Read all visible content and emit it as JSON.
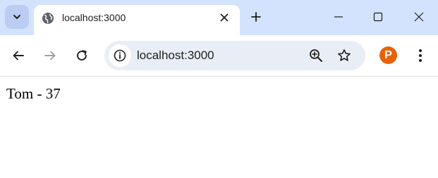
{
  "browser": {
    "tab": {
      "title": "localhost:3000",
      "icon": "globe-icon"
    },
    "address_bar": {
      "url": "localhost:3000",
      "icons": [
        "site-info-icon",
        "zoom-icon",
        "bookmark-star-icon"
      ]
    },
    "toolbar_icons": [
      "back-arrow-icon",
      "forward-arrow-icon",
      "reload-icon",
      "profile-extension-icon",
      "kebab-menu-icon"
    ],
    "window_controls": [
      "minimize-icon",
      "maximize-icon",
      "close-window-icon"
    ],
    "colors": {
      "titlebar": "#d3e3fd",
      "omnibox": "#e9eef6",
      "profile": "#e8620c"
    }
  },
  "page": {
    "text": "Tom - 37"
  }
}
